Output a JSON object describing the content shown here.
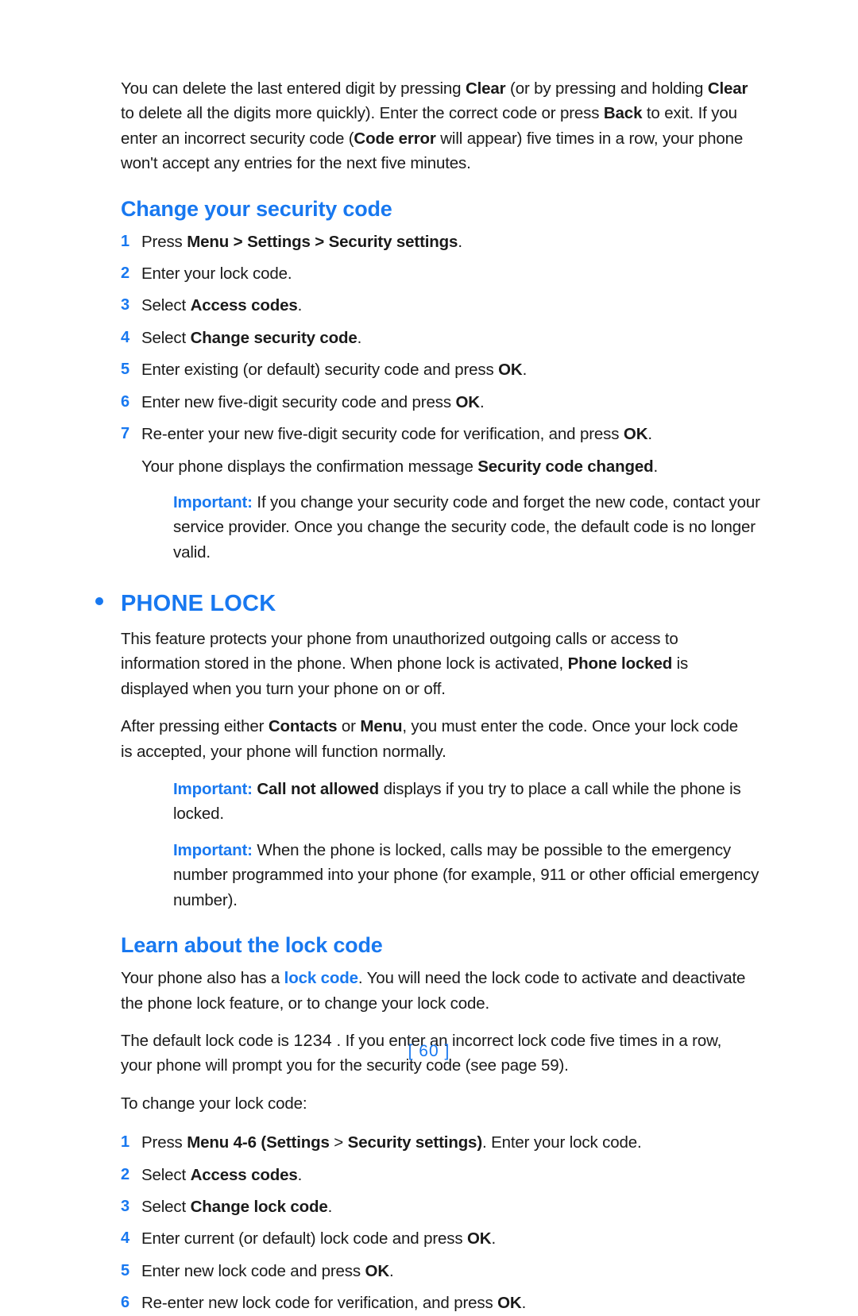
{
  "colors": {
    "accent": "#1878f0",
    "body_text": "#1a1a1a",
    "background": "#ffffff"
  },
  "intro": {
    "p1_part1": "You can delete the last entered digit by pressing ",
    "p1_b1": "Clear",
    "p1_part2": " (or by pressing and holding ",
    "p1_b2": "Clear",
    "p1_part3": " to delete all the digits more quickly). Enter the correct code or press ",
    "p1_b3": "Back",
    "p1_part4": " to exit. If you enter an incorrect security code (",
    "p1_b4": "Code error",
    "p1_part5": " will appear) five times in a row, your phone won't accept any entries for the next five minutes."
  },
  "section_change_security_code": {
    "heading": "Change your security code",
    "steps": [
      {
        "num": "1",
        "pre": "Press ",
        "b1": "Menu",
        "mid1": " > ",
        "b2": "Settings",
        "mid2": " > ",
        "b3": "Security settings",
        "post": "."
      },
      {
        "num": "2",
        "pre": "Enter your lock code.",
        "b1": "",
        "mid1": "",
        "b2": "",
        "mid2": "",
        "b3": "",
        "post": ""
      },
      {
        "num": "3",
        "pre": "Select ",
        "b1": "Access codes",
        "mid1": "",
        "b2": "",
        "mid2": "",
        "b3": "",
        "post": "."
      },
      {
        "num": "4",
        "pre": "Select ",
        "b1": "Change security code",
        "mid1": "",
        "b2": "",
        "mid2": "",
        "b3": "",
        "post": "."
      },
      {
        "num": "5",
        "pre": "Enter existing (or default) security code and press ",
        "b1": "OK",
        "mid1": "",
        "b2": "",
        "mid2": "",
        "b3": "",
        "post": "."
      },
      {
        "num": "6",
        "pre": "Enter new five-digit security code and press ",
        "b1": "OK",
        "mid1": "",
        "b2": "",
        "mid2": "",
        "b3": "",
        "post": "."
      },
      {
        "num": "7",
        "pre": "Re-enter your new five-digit security code for verification, and press ",
        "b1": "OK",
        "mid1": "",
        "b2": "",
        "mid2": "",
        "b3": "",
        "post": "."
      }
    ],
    "confirmation_pre": "Your phone displays the confirmation message ",
    "confirmation_bold": "Security code changed",
    "confirmation_post": ".",
    "note": {
      "label": "Important:",
      "text": " If you change your security code and forget the new code, contact your service provider. Once you change the security code, the default code is no longer valid."
    }
  },
  "section_phone_lock": {
    "heading": "PHONE LOCK",
    "bullet_icon": "bullet-dot-icon",
    "p1_pre": "This feature protects your phone from unauthorized outgoing calls or access to information stored in the phone. When phone lock is activated, ",
    "p1_bold": "Phone locked",
    "p1_post": " is displayed when you turn your phone on or off.",
    "p2_pre": "After pressing either ",
    "p2_b1": "Contacts",
    "p2_mid": " or ",
    "p2_b2": "Menu",
    "p2_post": ", you must enter the code. Once your lock code is accepted, your phone will function normally.",
    "note1": {
      "label": "Important:",
      "bold": "Call not allowed",
      "text": " displays if you try to place a call while the phone is locked."
    },
    "note2": {
      "label": "Important:",
      "text": " When the phone is locked, calls may be possible to the emergency number programmed into your phone (for example, 911 or other official emergency number)."
    }
  },
  "section_lock_code": {
    "heading": "Learn about the lock code",
    "p1_pre": "Your phone also has a ",
    "p1_blue": "lock code",
    "p1_post": ". You will need the lock code to activate and deactivate the phone lock feature, or to change your lock code.",
    "p2_pre": "The default lock code is ",
    "p2_code": "1234",
    "p2_post": " . If you enter an incorrect lock code five times in a row, your phone will prompt you for the security code (see page 59).",
    "p3": "To change your lock code:",
    "steps": [
      {
        "num": "1",
        "pre": "Press ",
        "b1": "Menu 4-6 (Settings",
        "mid1": " > ",
        "b2": "Security settings)",
        "post": ". Enter your lock code."
      },
      {
        "num": "2",
        "pre": "Select ",
        "b1": "Access codes",
        "mid1": "",
        "b2": "",
        "post": "."
      },
      {
        "num": "3",
        "pre": "Select ",
        "b1": "Change lock code",
        "mid1": "",
        "b2": "",
        "post": "."
      },
      {
        "num": "4",
        "pre": "Enter current (or default) lock code and press ",
        "b1": "OK",
        "mid1": "",
        "b2": "",
        "post": "."
      },
      {
        "num": "5",
        "pre": "Enter new lock code and press ",
        "b1": "OK",
        "mid1": "",
        "b2": "",
        "post": "."
      },
      {
        "num": "6",
        "pre": "Re-enter new lock code for verification, and press ",
        "b1": "OK",
        "mid1": "",
        "b2": "",
        "post": "."
      }
    ]
  },
  "footer": {
    "page_number": "[ 60 ]"
  }
}
